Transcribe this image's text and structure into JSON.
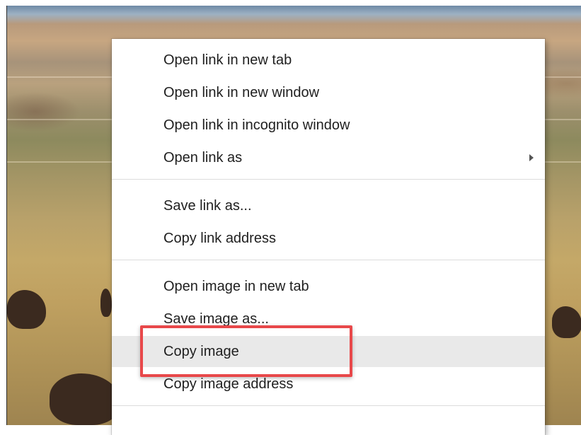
{
  "context_menu": {
    "items": [
      {
        "label": "Open link in new tab"
      },
      {
        "label": "Open link in new window"
      },
      {
        "label": "Open link in incognito window"
      },
      {
        "label": "Open link as",
        "has_submenu": true
      },
      {
        "label": "Save link as..."
      },
      {
        "label": "Copy link address"
      },
      {
        "label": "Open image in new tab"
      },
      {
        "label": "Save image as..."
      },
      {
        "label": "Copy image",
        "highlighted": true
      },
      {
        "label": "Copy image address"
      }
    ]
  },
  "colors": {
    "callout_border": "#e8484a",
    "highlight_bg": "#e9e9e9"
  }
}
